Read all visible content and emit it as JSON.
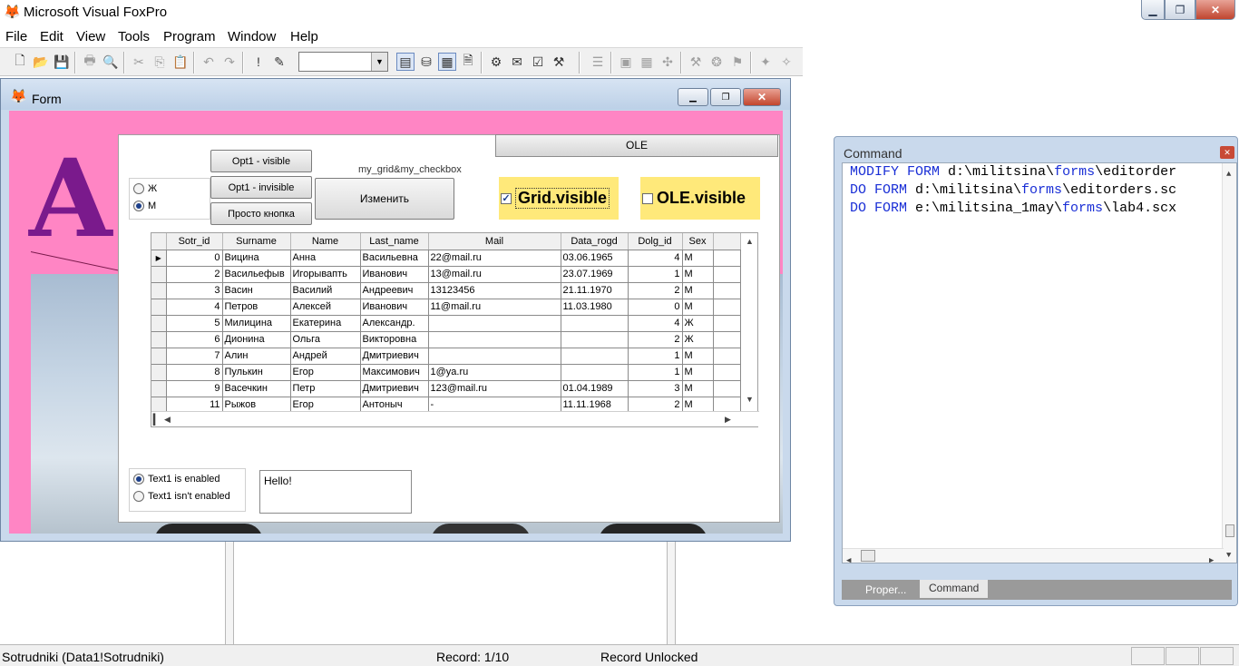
{
  "app": {
    "title": "Microsoft Visual FoxPro"
  },
  "menu": [
    {
      "label": "File"
    },
    {
      "label": "Edit"
    },
    {
      "label": "View"
    },
    {
      "label": "Tools"
    },
    {
      "label": "Program"
    },
    {
      "label": "Window"
    },
    {
      "label": "Help"
    }
  ],
  "toolbar": {
    "combo_value": ""
  },
  "form": {
    "title": "Form",
    "tab_grid": "my_grid&my_checkbox",
    "tab_ole": "OLE",
    "gender_options": [
      "Ж",
      "М"
    ],
    "gender_selected": "М",
    "btn_opt1_visible": "Opt1 - visible",
    "btn_opt1_invisible": "Opt1  - invisible",
    "btn_simple": "Просто кнопка",
    "btn_change": "Изменить",
    "chk_grid_label": "Grid.visible",
    "chk_grid_checked": true,
    "chk_ole_label": "OLE.visible",
    "chk_ole_checked": false,
    "grid_columns": [
      "Sotr_id",
      "Surname",
      "Name",
      "Last_name",
      "Mail",
      "Data_rogd",
      "Dolg_id",
      "Sex"
    ],
    "grid_rows": [
      [
        "0",
        "Вицина",
        "Анна",
        "Васильевна",
        "22@mail.ru",
        "03.06.1965",
        "4",
        "М"
      ],
      [
        "2",
        "Васильефыв",
        "Игорывапть",
        "Иванович",
        "13@mail.ru",
        "23.07.1969",
        "1",
        "М"
      ],
      [
        "3",
        "Васин",
        "Василий",
        "Андреевич",
        "13123456",
        "21.11.1970",
        "2",
        "М"
      ],
      [
        "4",
        "Петров",
        "Алексей",
        "Иванович",
        "11@mail.ru",
        "11.03.1980",
        "0",
        "М"
      ],
      [
        "5",
        "Милицина",
        "Екатерина",
        "Александр.",
        "",
        "",
        "4",
        "Ж"
      ],
      [
        "6",
        "Дионина",
        "Ольга",
        "Викторовна",
        "",
        "",
        "2",
        "Ж"
      ],
      [
        "7",
        "Алин",
        "Андрей",
        "Дмитриевич",
        "",
        "",
        "1",
        "М"
      ],
      [
        "8",
        "Пулькин",
        "Егор",
        "Максимович",
        "1@ya.ru",
        "",
        "1",
        "М"
      ],
      [
        "9",
        "Васечкин",
        "Петр",
        "Дмитриевич",
        "123@mail.ru",
        "01.04.1989",
        "3",
        "М"
      ],
      [
        "11",
        "Рыжов",
        "Егор",
        "Антоныч",
        "-",
        "11.11.1968",
        "2",
        "М"
      ]
    ],
    "text_options": [
      "Text1 is enabled",
      "Text1 isn't enabled"
    ],
    "text_option_selected": "Text1 is enabled",
    "text1_value": "Hello!"
  },
  "command": {
    "title": "Command",
    "lines": [
      [
        {
          "t": "MODIFY FORM",
          "k": true
        },
        {
          "t": " d:\\militsina\\",
          "k": false
        },
        {
          "t": "forms",
          "k": true
        },
        {
          "t": "\\editorder",
          "k": false
        }
      ],
      [
        {
          "t": "DO FORM",
          "k": true
        },
        {
          "t": " d:\\militsina\\",
          "k": false
        },
        {
          "t": "forms",
          "k": true
        },
        {
          "t": "\\editorders.sc",
          "k": false
        }
      ],
      [
        {
          "t": "DO FORM",
          "k": true
        },
        {
          "t": " e:\\militsina_1may\\",
          "k": false
        },
        {
          "t": "forms",
          "k": true
        },
        {
          "t": "\\lab4.scx",
          "k": false
        }
      ]
    ],
    "tab_properties": "Proper...",
    "tab_command": "Command"
  },
  "status": {
    "alias": "Sotrudniki (Data1!Sotrudniki)",
    "record": "Record: 1/10",
    "lock": "Record Unlocked"
  },
  "colors": {
    "form_bg": "#ff85c4",
    "checkbox_bg": "#ffe97a",
    "command_keyword": "#1a2fd6"
  }
}
